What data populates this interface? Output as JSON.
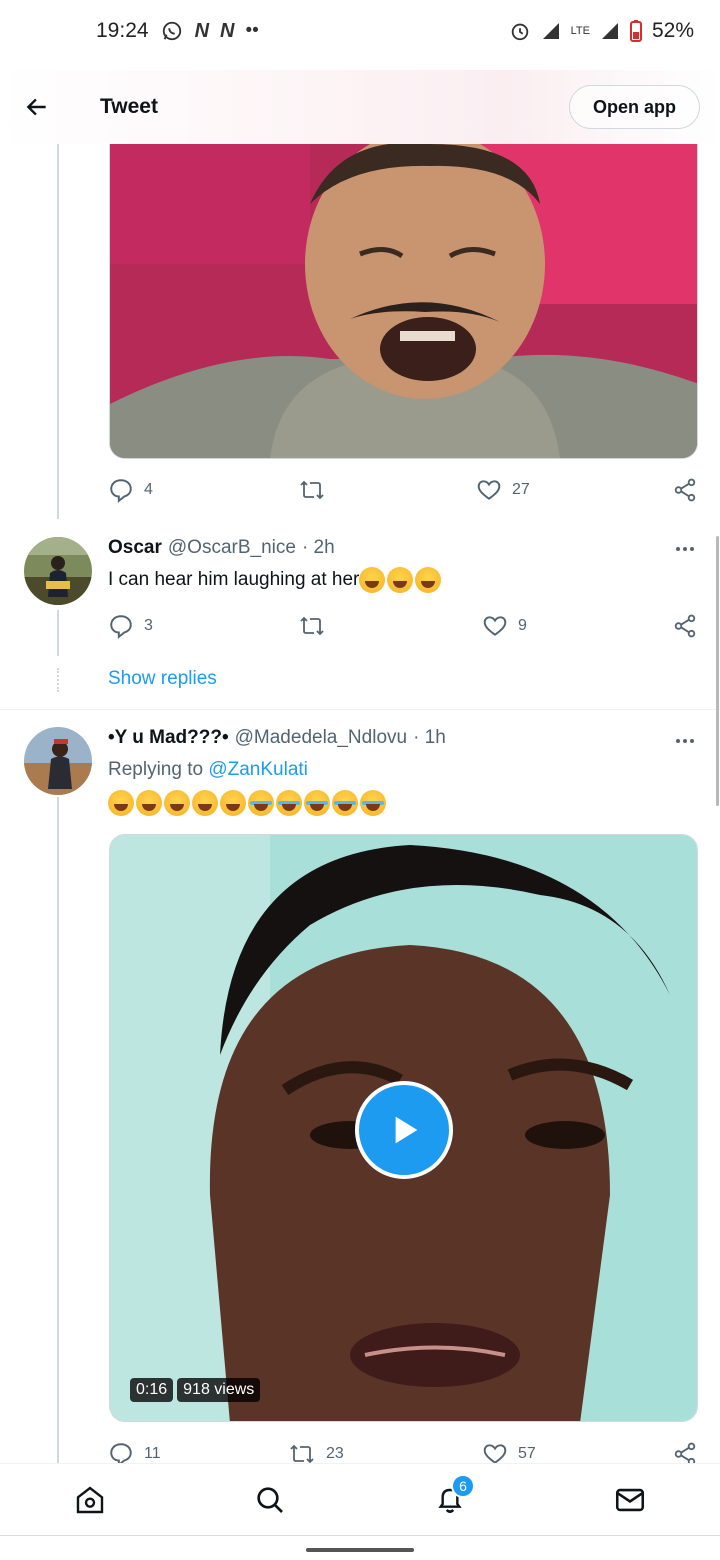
{
  "status_bar": {
    "time": "19:24",
    "left_icons": [
      "whatsapp-icon",
      "n-icon",
      "n-icon",
      "more-dots-icon"
    ],
    "network": "LTE",
    "battery": "52%"
  },
  "header": {
    "title": "Tweet",
    "open_app_label": "Open app"
  },
  "tweets": [
    {
      "actions": {
        "replies": "4",
        "retweets": "",
        "likes": "27"
      }
    },
    {
      "name": "Oscar",
      "handle": "@OscarB_nice",
      "time": "· 2h",
      "text": "I can hear him laughing at her",
      "emojis": [
        "face-with-tears-of-joy",
        "face-with-tears-of-joy",
        "face-with-tears-of-joy"
      ],
      "actions": {
        "replies": "3",
        "retweets": "",
        "likes": "9"
      },
      "show_replies": "Show replies"
    },
    {
      "name": "•Y u Mad???•",
      "handle": "@Madedela_Ndlovu",
      "time": "· 1h",
      "replying_prefix": "Replying to",
      "replying_to": "@ZanKulati",
      "emojis": [
        "weary-face",
        "weary-face",
        "weary-face",
        "weary-face",
        "weary-face",
        "loudly-crying-face",
        "loudly-crying-face",
        "loudly-crying-face",
        "loudly-crying-face",
        "loudly-crying-face"
      ],
      "video": {
        "duration": "0:16",
        "views": "918 views"
      },
      "actions": {
        "replies": "11",
        "retweets": "23",
        "likes": "57"
      }
    }
  ],
  "bottom_nav": {
    "items": [
      "home-icon",
      "search-icon",
      "notifications-icon",
      "messages-icon"
    ],
    "notification_count": "6"
  },
  "colors": {
    "accent": "#1d9bf0",
    "text_primary": "#0f1419",
    "text_secondary": "#536471"
  }
}
